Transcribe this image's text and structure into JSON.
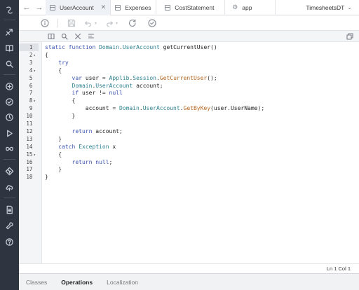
{
  "tabs": [
    {
      "label": "UserAccount",
      "icon": "document-icon",
      "active": true,
      "closable": true
    },
    {
      "label": "Expenses",
      "icon": "document-icon",
      "active": false
    },
    {
      "label": "CostStatement",
      "icon": "document-icon",
      "active": false
    },
    {
      "label": "app",
      "icon": "gear-icon",
      "active": false
    }
  ],
  "project": {
    "label": "TimesheetsDT",
    "icon": "chevron-down-icon"
  },
  "nav": {
    "back_icon": "arrow-left-icon",
    "forward_icon": "arrow-right-icon"
  },
  "toolbar": {
    "buttons": [
      "info-icon",
      "save-icon",
      "undo-icon",
      "redo-icon",
      "refresh-icon",
      "check-icon"
    ]
  },
  "editor_toolbar": {
    "buttons": [
      "layout-icon",
      "search-icon",
      "replace-icon",
      "format-icon",
      "maximize-icon"
    ]
  },
  "code": {
    "language": "javascript",
    "current_line": 1,
    "lines": [
      {
        "n": "1",
        "fold": ""
      },
      {
        "n": "2",
        "fold": "▾"
      },
      {
        "n": "3",
        "fold": ""
      },
      {
        "n": "4",
        "fold": "▾"
      },
      {
        "n": "5",
        "fold": ""
      },
      {
        "n": "6",
        "fold": ""
      },
      {
        "n": "7",
        "fold": ""
      },
      {
        "n": "8",
        "fold": "▾"
      },
      {
        "n": "9",
        "fold": ""
      },
      {
        "n": "10",
        "fold": ""
      },
      {
        "n": "11",
        "fold": ""
      },
      {
        "n": "12",
        "fold": ""
      },
      {
        "n": "13",
        "fold": ""
      },
      {
        "n": "14",
        "fold": ""
      },
      {
        "n": "15",
        "fold": "▾"
      },
      {
        "n": "16",
        "fold": ""
      },
      {
        "n": "17",
        "fold": ""
      },
      {
        "n": "18",
        "fold": ""
      }
    ],
    "text": [
      "static function Domain.UserAccount getCurrentUser()",
      "{",
      "    try",
      "    {",
      "        var user = Applib.Session.GetCurrentUser();",
      "        Domain.UserAccount account;",
      "        if user != null",
      "        {",
      "            account = Domain.UserAccount.GetByKey(user.UserName);",
      "        }",
      "",
      "        return account;",
      "    }",
      "    catch Exception x",
      "    {",
      "        return null;",
      "    }",
      "}"
    ]
  },
  "status": {
    "cursor": "Ln 1 Col 1"
  },
  "bottom_tabs": [
    {
      "label": "Classes",
      "active": false
    },
    {
      "label": "Operations",
      "active": true
    },
    {
      "label": "Localization",
      "active": false
    }
  ],
  "sidebar": {
    "icons": [
      "logo-icon",
      "rocket-icon",
      "book-icon",
      "search-icon",
      "add-icon",
      "check-circle-icon",
      "history-icon",
      "play-icon",
      "infinity-icon",
      "git-icon",
      "cloud-upload-icon",
      "document-icon",
      "wrench-icon",
      "help-icon"
    ]
  }
}
